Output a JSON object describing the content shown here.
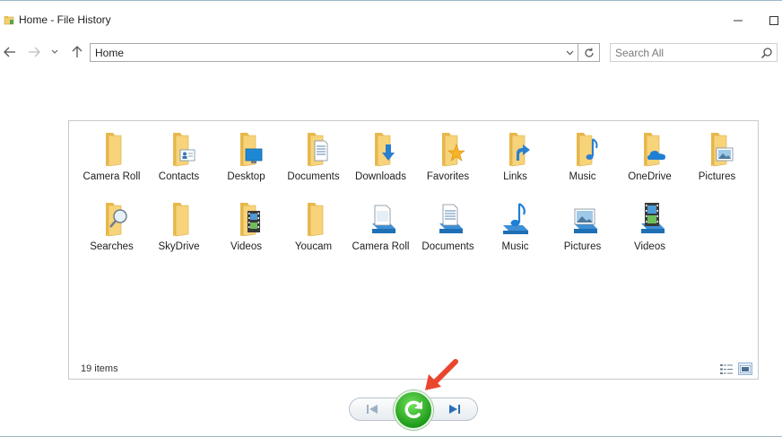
{
  "window": {
    "title": "Home - File History",
    "app_icon": "file-history-folder-icon"
  },
  "navigation": {
    "back_icon": "back-arrow-icon",
    "forward_icon": "forward-arrow-icon",
    "recent_icon": "chevron-down-icon",
    "up_icon": "up-arrow-icon",
    "address_value": "Home",
    "refresh_icon": "refresh-icon",
    "search_placeholder": "Search All",
    "search_icon": "search-icon"
  },
  "items": [
    {
      "label": "Camera Roll",
      "icon": "folder-icon"
    },
    {
      "label": "Contacts",
      "icon": "contacts-folder-icon"
    },
    {
      "label": "Desktop",
      "icon": "desktop-folder-icon"
    },
    {
      "label": "Documents",
      "icon": "documents-folder-icon"
    },
    {
      "label": "Downloads",
      "icon": "downloads-folder-icon"
    },
    {
      "label": "Favorites",
      "icon": "favorites-folder-icon"
    },
    {
      "label": "Links",
      "icon": "links-folder-icon"
    },
    {
      "label": "Music",
      "icon": "music-folder-icon"
    },
    {
      "label": "OneDrive",
      "icon": "onedrive-folder-icon"
    },
    {
      "label": "Pictures",
      "icon": "pictures-folder-icon"
    },
    {
      "label": "Searches",
      "icon": "searches-folder-icon"
    },
    {
      "label": "SkyDrive",
      "icon": "folder-icon"
    },
    {
      "label": "Videos",
      "icon": "videos-folder-icon"
    },
    {
      "label": "Youcam",
      "icon": "folder-icon"
    },
    {
      "label": "Camera Roll",
      "icon": "camera-roll-library-icon"
    },
    {
      "label": "Documents",
      "icon": "documents-library-icon"
    },
    {
      "label": "Music",
      "icon": "music-library-icon"
    },
    {
      "label": "Pictures",
      "icon": "pictures-library-icon"
    },
    {
      "label": "Videos",
      "icon": "videos-library-icon"
    }
  ],
  "status": {
    "item_count": "19 items"
  },
  "controls": {
    "previous_icon": "previous-version-icon",
    "restore_icon": "restore-icon",
    "next_icon": "next-version-icon"
  },
  "colors": {
    "folder": "#f4cf6e",
    "restore_green": "#2ea72a",
    "accent_blue": "#1e88d4",
    "annotation_red": "#e8472e"
  }
}
